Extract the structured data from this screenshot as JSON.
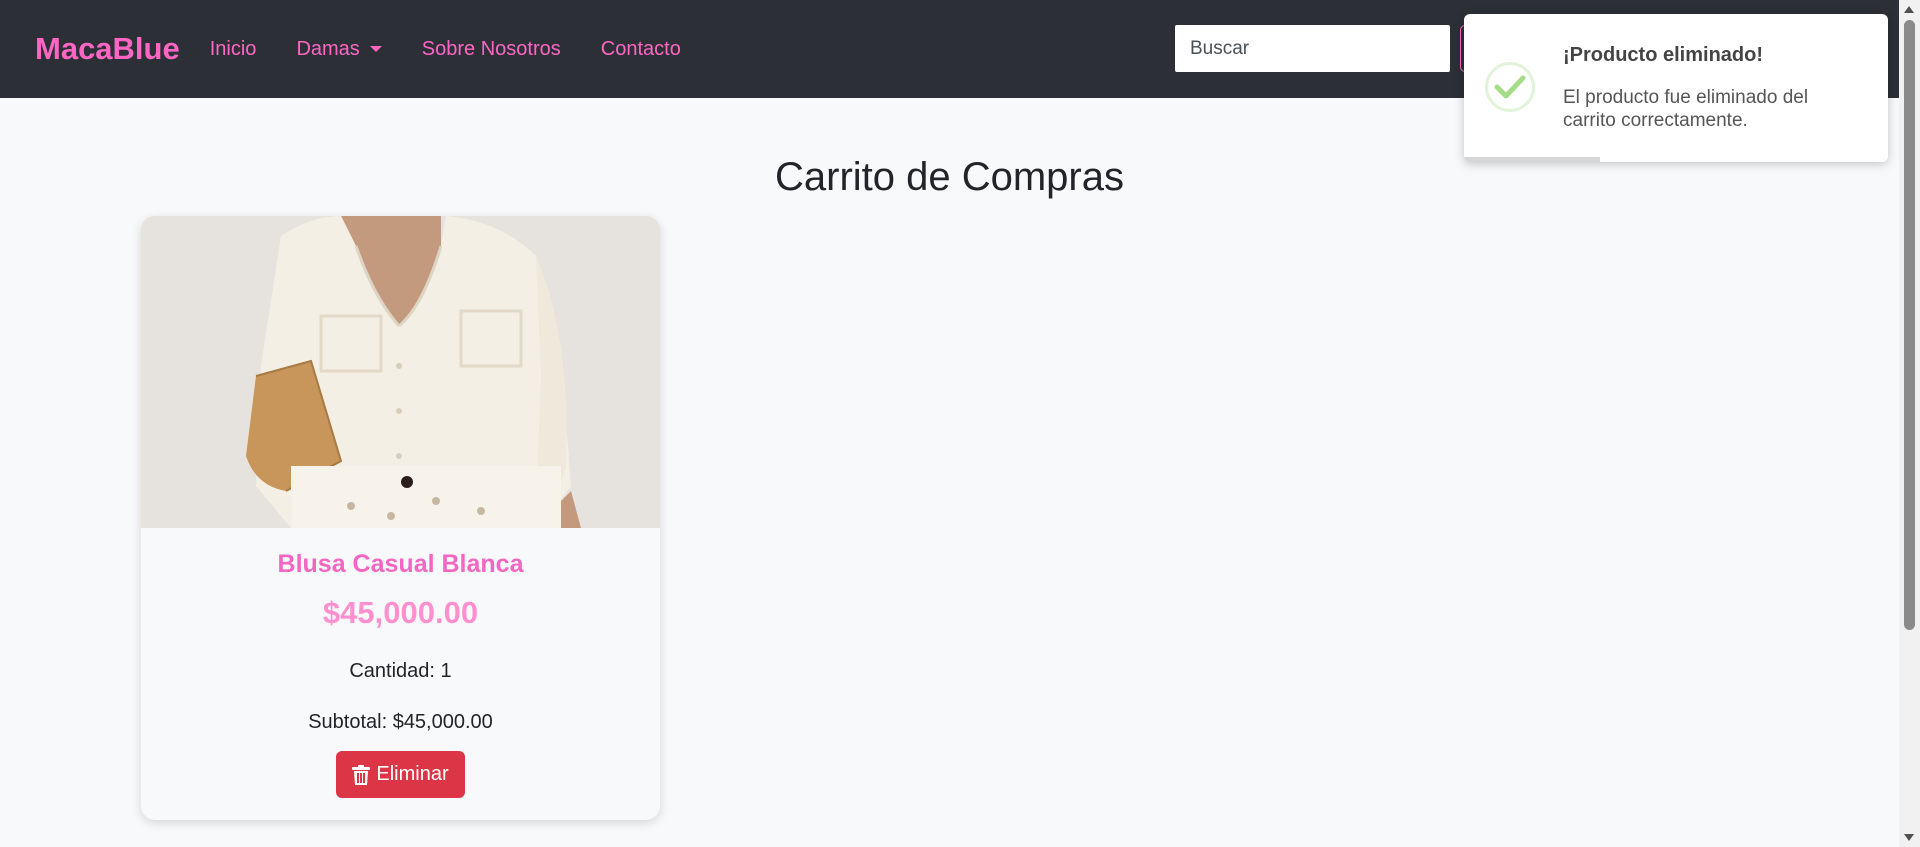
{
  "navbar": {
    "brand": "MacaBlue",
    "links": [
      {
        "label": "Inicio"
      },
      {
        "label": "Damas"
      },
      {
        "label": "Sobre Nosotros"
      },
      {
        "label": "Contacto"
      }
    ],
    "search_placeholder": "Buscar"
  },
  "page": {
    "title": "Carrito de Compras"
  },
  "cart_items": [
    {
      "name": "Blusa Casual Blanca",
      "price": "$45,000.00",
      "quantity_text": "Cantidad: 1",
      "subtotal_text": "Subtotal: $45,000.00",
      "delete_label": "Eliminar"
    }
  ],
  "toast": {
    "title": "¡Producto eliminado!",
    "message": "El producto fue eliminado del carrito correctamente.",
    "icon": "check-circle-icon",
    "progress": 0.32
  },
  "colors": {
    "navbar_bg": "#2c3036",
    "accent_pink": "#ff66c4",
    "delete_red": "#dc3545",
    "success_green": "#a5dc86"
  }
}
